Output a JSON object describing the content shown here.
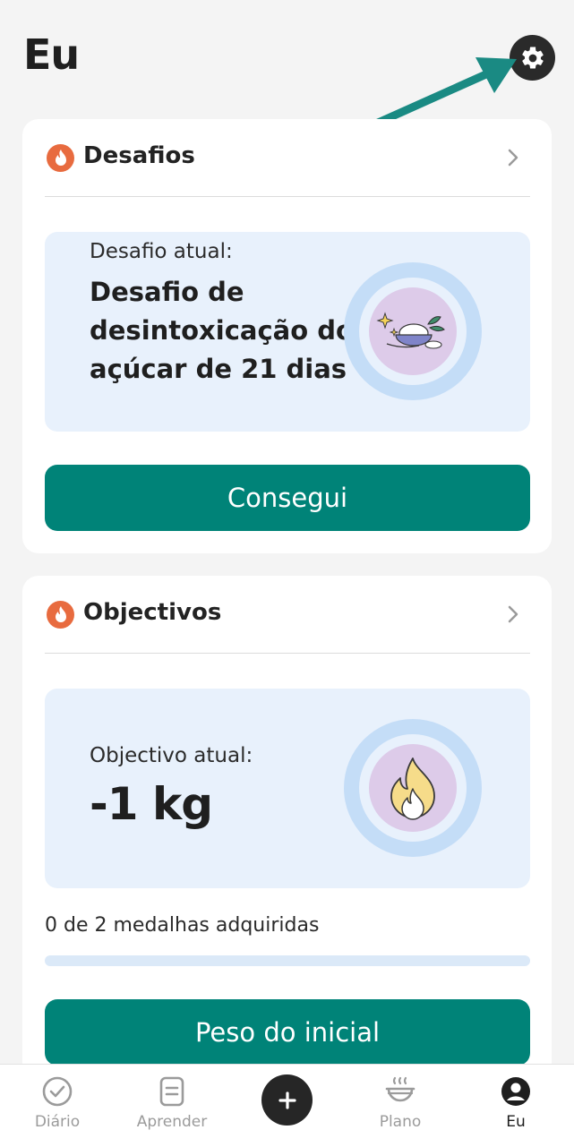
{
  "page": {
    "title": "Eu"
  },
  "settings": {
    "icon": "gear-icon"
  },
  "challenges": {
    "title": "Desafios",
    "icon": "flame-icon",
    "current_label": "Desafio atual:",
    "current_name": "Desafio de desintoxicação do açúcar de 21 dias",
    "illustration": "bowl-spoon-icon",
    "button_label": "Consegui"
  },
  "goals": {
    "title": "Objectivos",
    "icon": "flame-icon",
    "current_label": "Objectivo atual:",
    "current_value": "-1 kg",
    "illustration": "flame-icon",
    "medals_text": "0 de 2 medalhas adquiridas",
    "medals_progress": 0,
    "button_label": "Peso do inicial"
  },
  "nav": {
    "items": [
      {
        "label": "Diário",
        "icon": "check-circle-icon"
      },
      {
        "label": "Aprender",
        "icon": "document-icon"
      },
      {
        "label": "",
        "icon": "plus-icon"
      },
      {
        "label": "Plano",
        "icon": "steaming-bowl-icon"
      },
      {
        "label": "Eu",
        "icon": "profile-icon"
      }
    ],
    "active": "Eu"
  },
  "colors": {
    "accent": "#008378",
    "flame": "#e86b3f",
    "annotation_arrow": "#1a8a83",
    "hero_bg": "#e8f1fc"
  }
}
